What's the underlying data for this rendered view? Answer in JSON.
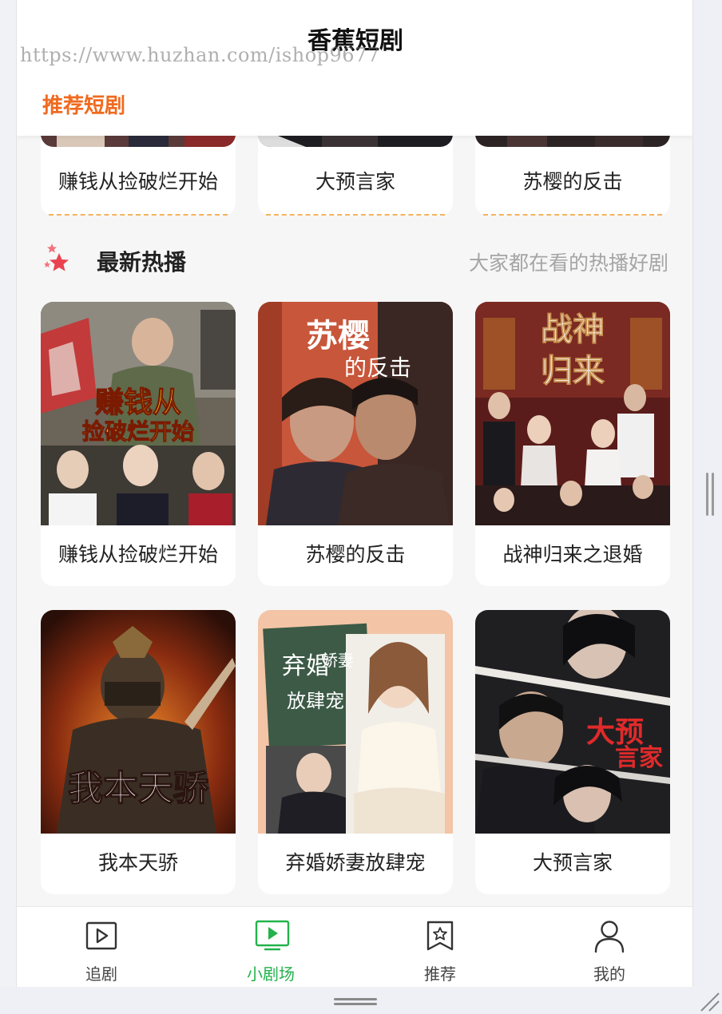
{
  "header": {
    "title": "香蕉短剧",
    "watermark": "https://www.huzhan.com/ishop9677",
    "section_tab": "推荐短剧"
  },
  "top_row": [
    {
      "title": "赚钱从捡破烂开始"
    },
    {
      "title": "大预言家"
    },
    {
      "title": "苏樱的反击"
    }
  ],
  "hot": {
    "title": "最新热播",
    "subtitle": "大家都在看的热播好剧",
    "items": [
      {
        "title": "赚钱从捡破烂开始",
        "poster_text": "赚钱从捡破烂开始"
      },
      {
        "title": "苏樱的反击",
        "poster_text": "苏樱的反击"
      },
      {
        "title": "战神归来之退婚",
        "poster_text": "战神归来"
      },
      {
        "title": "我本天骄",
        "poster_text": "我本天骄"
      },
      {
        "title": "弃婚娇妻放肆宠",
        "poster_text": "弃婚娇妻放肆宠"
      },
      {
        "title": "大预言家",
        "poster_text": "大预言家"
      }
    ]
  },
  "nav": {
    "items": [
      {
        "label": "追剧",
        "icon": "play-square-icon"
      },
      {
        "label": "小剧场",
        "icon": "tv-play-icon",
        "active": true
      },
      {
        "label": "推荐",
        "icon": "star-bookmark-icon"
      },
      {
        "label": "我的",
        "icon": "user-icon"
      }
    ]
  },
  "colors": {
    "accent": "#f06a1f",
    "active_nav": "#23b24b",
    "dash": "#f4b25e",
    "hot_icon": "#e9434f"
  }
}
